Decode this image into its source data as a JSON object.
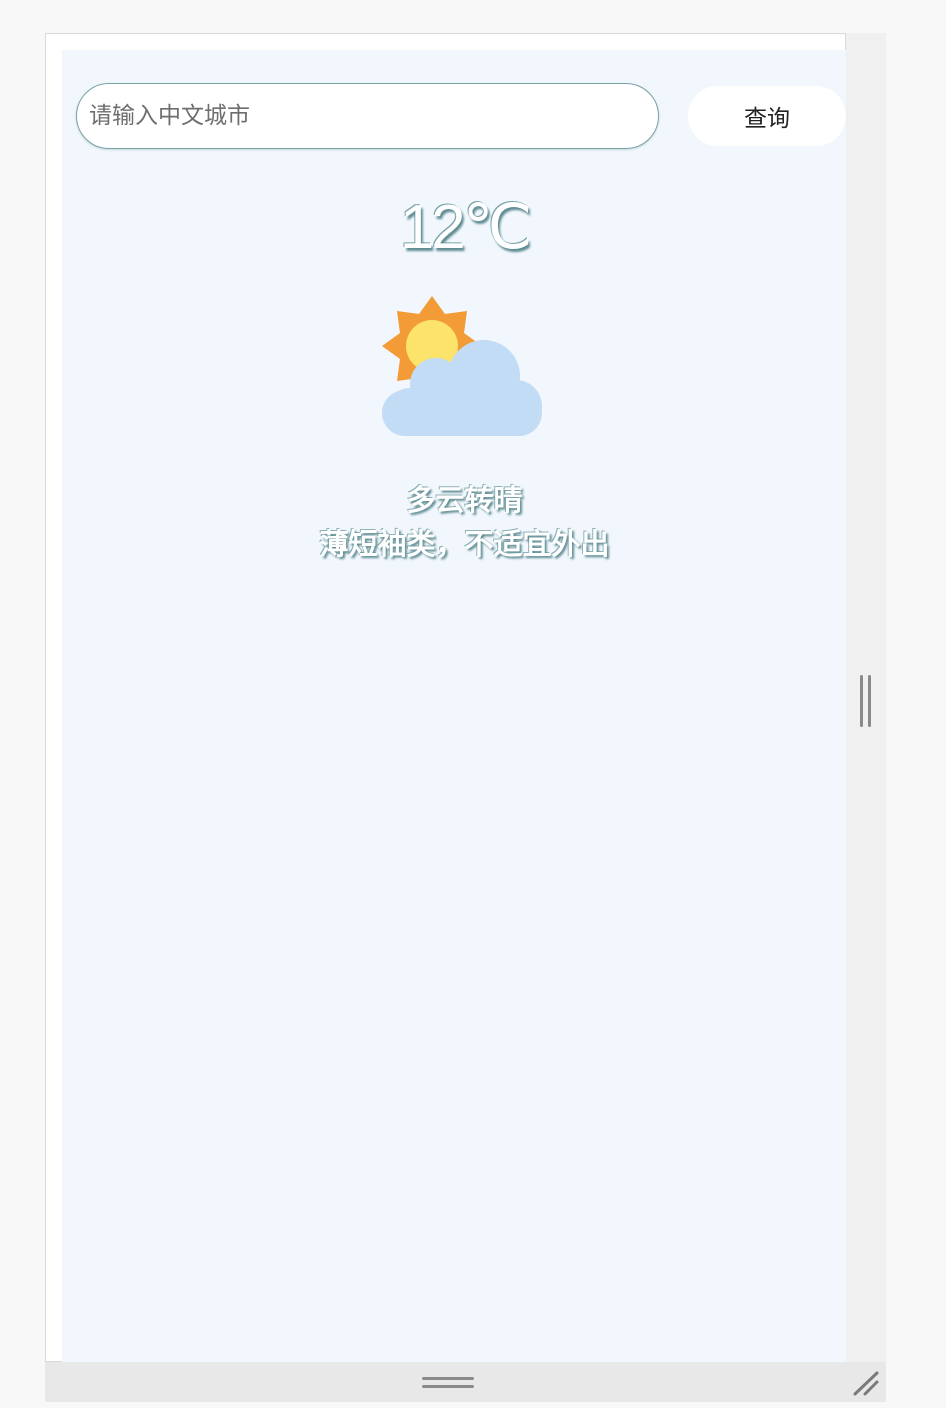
{
  "search": {
    "placeholder": "请输入中文城市",
    "value": "",
    "button_label": "查询"
  },
  "weather": {
    "temperature": "12℃",
    "icon": "partly-cloudy-sun-icon",
    "description": "多云转晴",
    "advice": "薄短袖类，不适宜外出"
  },
  "colors": {
    "background": "#f1f7fd",
    "sun_outer": "#f39b36",
    "sun_inner": "#fbe36c",
    "cloud": "#c3dcf5",
    "text_shadow": "#5e8c92",
    "input_border": "#7aa2a6"
  }
}
